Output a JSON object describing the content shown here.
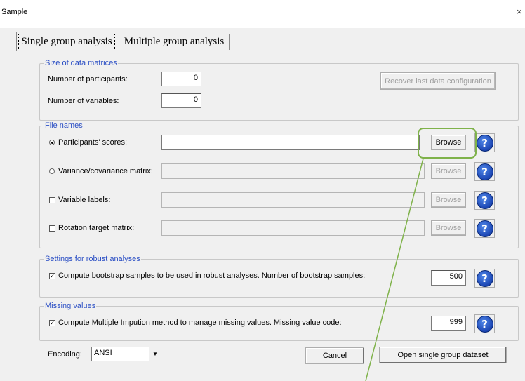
{
  "window": {
    "title": "Sample",
    "close_glyph": "×"
  },
  "tabs": [
    {
      "label": "Single group analysis",
      "active": true
    },
    {
      "label": "Multiple group analysis",
      "active": false
    }
  ],
  "size_section": {
    "legend": "Size of data matrices",
    "participants_label": "Number of participants:",
    "participants_value": "0",
    "variables_label": "Number of variables:",
    "variables_value": "0",
    "recover_button": "Recover last data configuration"
  },
  "files_section": {
    "legend": "File names",
    "rows": [
      {
        "label": "Participants' scores:",
        "control": "radio",
        "checked": true,
        "browse": "Browse",
        "enabled": true
      },
      {
        "label": "Variance/covariance matrix:",
        "control": "radio",
        "checked": false,
        "browse": "Browse",
        "enabled": false
      },
      {
        "label": "Variable labels:",
        "control": "checkbox",
        "checked": false,
        "browse": "Browse",
        "enabled": false
      },
      {
        "label": "Rotation target matrix:",
        "control": "checkbox",
        "checked": false,
        "browse": "Browse",
        "enabled": false
      }
    ],
    "help_glyph": "?"
  },
  "robust_section": {
    "legend": "Settings for robust analyses",
    "checkbox_label": "Compute bootstrap samples to be used in robust analyses. Number of bootstrap samples:",
    "checked": true,
    "samples_value": "500"
  },
  "missing_section": {
    "legend": "Missing values",
    "checkbox_label": "Compute Multiple Impution method to manage missing values. Missing value code:",
    "checked": true,
    "code_value": "999"
  },
  "footer": {
    "encoding_label": "Encoding:",
    "encoding_value": "ANSI",
    "cancel_button": "Cancel",
    "open_button": "Open single group dataset"
  },
  "colors": {
    "legend_text": "#2a4ec4",
    "highlight": "#7fb24a",
    "help_blue": "#1d47b4"
  }
}
